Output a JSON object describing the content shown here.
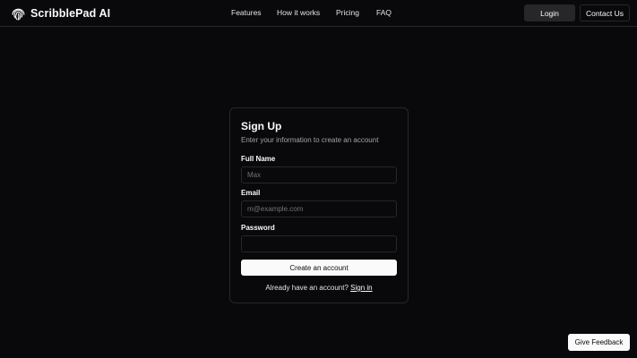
{
  "header": {
    "brand": "ScribblePad AI",
    "logo_icon": "fingerprint-icon",
    "nav": [
      {
        "label": "Features"
      },
      {
        "label": "How it works"
      },
      {
        "label": "Pricing"
      },
      {
        "label": "FAQ"
      }
    ],
    "login_label": "Login",
    "contact_label": "Contact Us"
  },
  "signup": {
    "title": "Sign Up",
    "subtitle": "Enter your information to create an account",
    "full_name": {
      "label": "Full Name",
      "placeholder": "Max",
      "value": ""
    },
    "email": {
      "label": "Email",
      "placeholder": "m@example.com",
      "value": ""
    },
    "password": {
      "label": "Password",
      "value": ""
    },
    "submit_label": "Create an account",
    "signin_prompt": "Already have an account?",
    "signin_link": "Sign in"
  },
  "feedback_label": "Give Feedback",
  "colors": {
    "background": "#09090b",
    "border": "#27272a",
    "foreground": "#fafafa",
    "muted": "#a1a1aa"
  }
}
